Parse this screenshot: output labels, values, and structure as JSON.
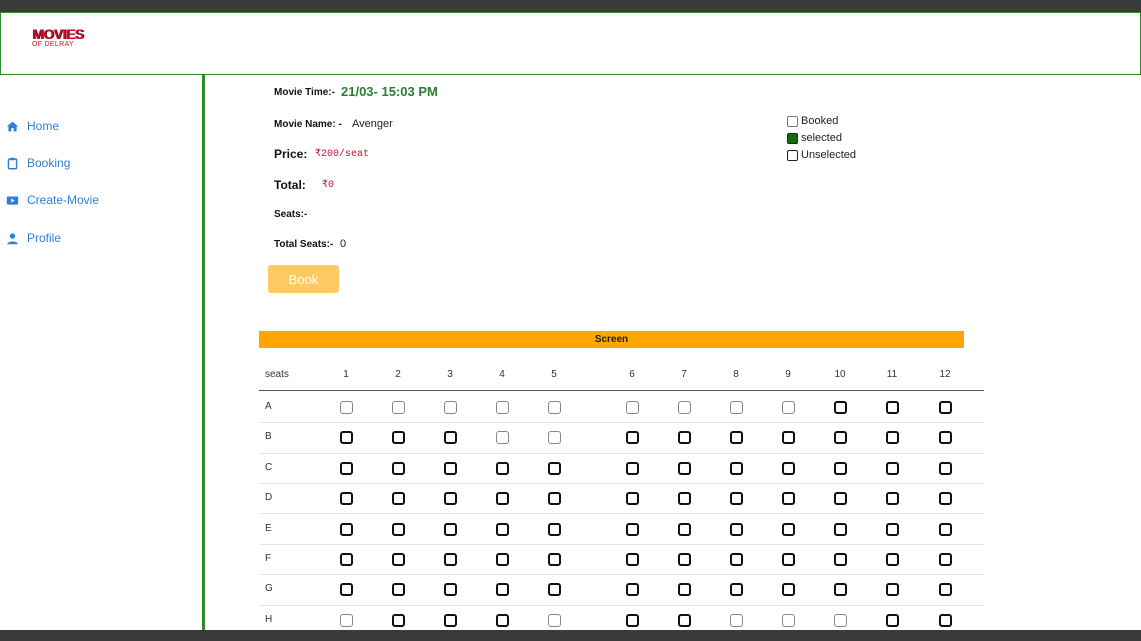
{
  "brand": {
    "line1": "MOVIES",
    "line2": "OF DELRAY"
  },
  "nav": [
    {
      "label": "Home",
      "icon": "home-icon"
    },
    {
      "label": "Booking",
      "icon": "clipboard-icon"
    },
    {
      "label": "Create-Movie",
      "icon": "video-icon"
    },
    {
      "label": "Profile",
      "icon": "user-icon"
    }
  ],
  "info": {
    "time_label": "Movie Time:-",
    "time_value": "21/03- 15:03 PM",
    "name_label": "Movie Name: -",
    "name_value": "Avenger",
    "price_label": "Price:",
    "price_value": "₹200/seat",
    "total_label": "Total:",
    "total_value": "₹0",
    "seats_label": "Seats:-",
    "seats_value": "",
    "total_seats_label": "Total Seats:-",
    "total_seats_value": "0"
  },
  "legend": {
    "booked": "Booked",
    "selected": "selected",
    "unselected": "Unselected"
  },
  "book_button": "Book",
  "screen_label": "Screen",
  "seats_header": "seats",
  "columns": [
    "1",
    "2",
    "3",
    "4",
    "5",
    "6",
    "7",
    "8",
    "9",
    "10",
    "11",
    "12"
  ],
  "rows": [
    {
      "label": "A",
      "booked": [
        1,
        2,
        3,
        4,
        5,
        6,
        7,
        8,
        9
      ]
    },
    {
      "label": "B",
      "booked": [
        4,
        5
      ]
    },
    {
      "label": "C",
      "booked": []
    },
    {
      "label": "D",
      "booked": []
    },
    {
      "label": "E",
      "booked": []
    },
    {
      "label": "F",
      "booked": []
    },
    {
      "label": "G",
      "booked": []
    },
    {
      "label": "H",
      "booked": [
        1,
        5,
        8,
        9,
        10
      ]
    }
  ],
  "colors": {
    "accent_green": "#2e8b2e",
    "selected_green": "#0d6e0d",
    "screen_orange": "#ffa500",
    "button": "#ffc964",
    "nav_blue": "#2f7fd8",
    "price_red": "#c8102e"
  }
}
